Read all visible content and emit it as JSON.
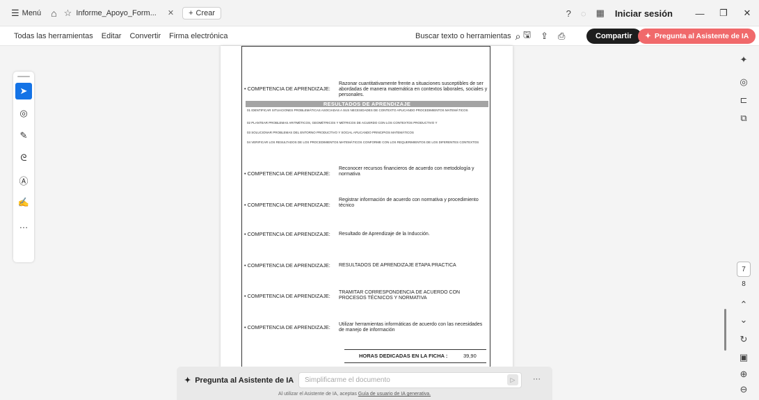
{
  "titlebar": {
    "menu_label": "Menú",
    "tab_title": "Informe_Apoyo_Form...",
    "new_tab_label": "Crear",
    "signin_label": "Iniciar sesión"
  },
  "toolbar": {
    "items": [
      "Todas las herramientas",
      "Editar",
      "Convertir",
      "Firma electrónica"
    ],
    "search_label": "Buscar texto o herramientas",
    "share_label": "Compartir",
    "ai_label": "Pregunta al Asistente de IA"
  },
  "document": {
    "competencias": [
      {
        "label": "• COMPETENCIA DE APRENDIZAJE:",
        "desc": "Razonar cuantitativamente frente a situaciones susceptibles de ser abordadas de manera matemática en contextos laborales, sociales y personales."
      },
      {
        "label": "• COMPETENCIA DE APRENDIZAJE:",
        "desc": "Reconocer recursos financieros de acuerdo con metodología y normativa"
      },
      {
        "label": "• COMPETENCIA DE APRENDIZAJE:",
        "desc": "Registrar información de acuerdo con normativa y procedimiento técnico"
      },
      {
        "label": "• COMPETENCIA DE APRENDIZAJE:",
        "desc": "Resultado de Aprendizaje de la Inducción."
      },
      {
        "label": "• COMPETENCIA DE APRENDIZAJE:",
        "desc": "RESULTADOS DE APRENDIZAJE ETAPA PRACTICA"
      },
      {
        "label": "• COMPETENCIA DE APRENDIZAJE:",
        "desc": "TRAMITAR CORRESPONDENCIA DE ACUERDO CON PROCESOS TÉCNICOS Y NORMATIVA"
      },
      {
        "label": "• COMPETENCIA DE APRENDIZAJE:",
        "desc": "Utilizar herramientas informáticas de acuerdo con las necesidades de manejo de información"
      }
    ],
    "resultados_title": "RESULTADOS DE APRENDIZAJE",
    "resultados": [
      "01 IDENTIFICAR SITUACIONES PROBLEMÁTICAS ASOCIADAS A SUS NECESIDADES DE CONTEXTO APLICANDO PROCEDIMIENTOS MATEMÁTICOS",
      "02 PLANTEAR PROBLEMAS ARITMÉTICOS, GEOMÉTRICOS Y MÉTRICOS DE ACUERDO CON LOS CONTEXTOS PRODUCTIVO Y",
      "03 SOLUCIONAR PROBLEMAS DEL ENTORNO PRODUCTIVO Y SOCIAL APLICANDO PRINCIPIOS MATEMÁTICOS",
      "04 VERIFICAR LOS RESULTADOS DE LOS PROCEDIMIENTOS MATEMÁTICOS CONFORME CON LOS REQUERIMIENTOS DE LOS DIFERENTES CONTEXTOS"
    ],
    "horas_label": "HORAS DEDICADAS EN LA FICHA :",
    "horas_value": "39,90"
  },
  "navigation": {
    "current_page": "7",
    "next_page": "8"
  },
  "aibar": {
    "title": "Pregunta al Asistente de IA",
    "placeholder": "Simplificarme el documento",
    "note_prefix": "Al utilizar el Asistente de IA, aceptas",
    "note_link": "Guía de usuario de IA generativa."
  },
  "colors": {
    "accent_blue": "#1473e6",
    "ai_button": "#f0696b",
    "share_button": "#1e1e1e"
  }
}
